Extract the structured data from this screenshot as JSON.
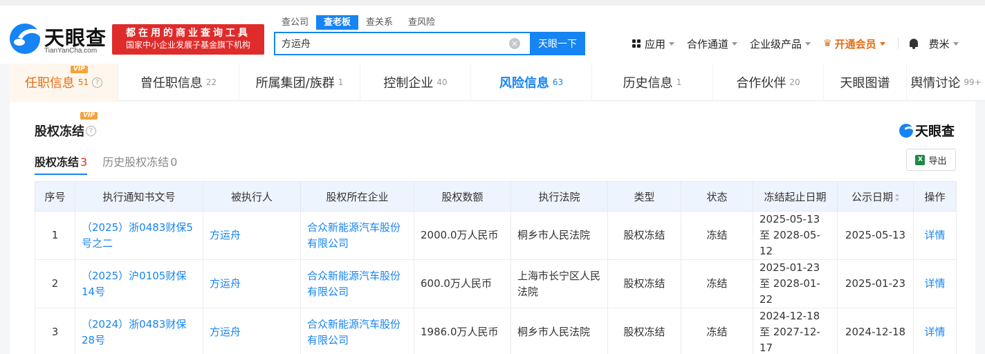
{
  "header": {
    "logo_name": "天眼查",
    "logo_url": "TianYanCha.com",
    "slogan_line1": "都在用的商业查询工具",
    "slogan_line2": "国家中小企业发展子基金旗下机构",
    "search_tabs": [
      "查公司",
      "查老板",
      "查关系",
      "查风险"
    ],
    "active_search_tab": "查老板",
    "search_value": "方运舟",
    "search_button": "天眼一下",
    "clear_symbol": "×",
    "nav": {
      "apps": "应用",
      "channel": "合作通道",
      "enterprise": "企业级产品",
      "vip": "开通会员",
      "user": "费米"
    }
  },
  "main_tabs": [
    {
      "label": "任职信息",
      "count": "51",
      "vip": "VIP"
    },
    {
      "label": "曾任职信息",
      "count": "22"
    },
    {
      "label": "所属集团/族群",
      "count": "1"
    },
    {
      "label": "控制企业",
      "count": "40"
    },
    {
      "label": "风险信息",
      "count": "63"
    },
    {
      "label": "历史信息",
      "count": "1"
    },
    {
      "label": "合作伙伴",
      "count": "20"
    },
    {
      "label": "天眼图谱",
      "count": ""
    },
    {
      "label": "舆情讨论",
      "count": "99+"
    }
  ],
  "section": {
    "title": "股权冻结",
    "vip": "VIP",
    "brand": "天眼查",
    "export": "导出",
    "excel_letter": "X",
    "help": "?",
    "sub_tabs": [
      {
        "label": "股权冻结",
        "count": "3"
      },
      {
        "label": "历史股权冻结",
        "count": "0"
      }
    ]
  },
  "table": {
    "columns": [
      "序号",
      "执行通知书文号",
      "被执行人",
      "股权所在企业",
      "股权数额",
      "执行法院",
      "类型",
      "状态",
      "冻结起止日期",
      "公示日期",
      "操作"
    ],
    "rows": [
      {
        "no": "1",
        "doc": "（2025）浙0483财保5号之二",
        "person": "方运舟",
        "company": "合众新能源汽车股份有限公司",
        "amount": "2000.0万人民币",
        "court": "桐乡市人民法院",
        "type": "股权冻结",
        "status": "冻结",
        "period": "2025-05-13 至 2028-05-12",
        "date": "2025-05-13",
        "action": "详情"
      },
      {
        "no": "2",
        "doc": "（2025）沪0105财保14号",
        "person": "方运舟",
        "company": "合众新能源汽车股份有限公司",
        "amount": "600.0万人民币",
        "court": "上海市长宁区人民法院",
        "type": "股权冻结",
        "status": "冻结",
        "period": "2025-01-23 至 2028-01-22",
        "date": "2025-01-23",
        "action": "详情"
      },
      {
        "no": "3",
        "doc": "（2024）浙0483财保28号",
        "person": "方运舟",
        "company": "合众新能源汽车股份有限公司",
        "amount": "1986.0万人民币",
        "court": "桐乡市人民法院",
        "type": "股权冻结",
        "status": "冻结",
        "period": "2024-12-18 至 2027-12-17",
        "date": "2024-12-18",
        "action": "详情"
      }
    ]
  },
  "colors": {
    "brand_blue": "#1684f2",
    "vip_orange": "#e56c13",
    "slogan_red": "#e02b2b"
  }
}
